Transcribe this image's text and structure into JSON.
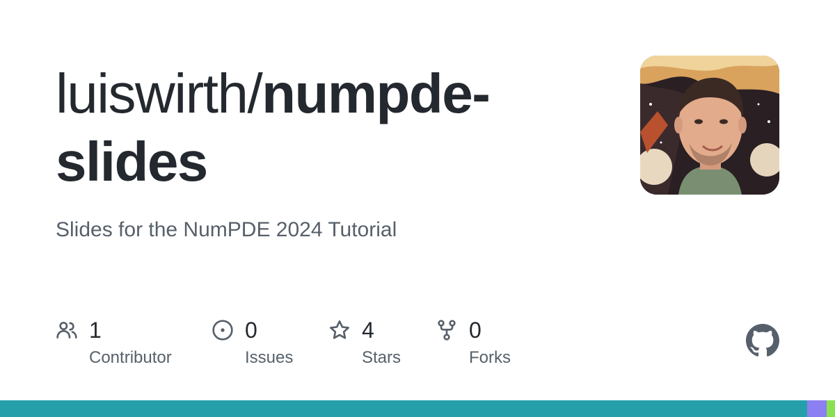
{
  "repo": {
    "owner": "luiswirth/",
    "name_line1": "numpde-",
    "name_line2": "slides",
    "description": "Slides for the NumPDE 2024 Tutorial"
  },
  "stats": [
    {
      "icon": "people-icon",
      "value": "1",
      "label": "Contributor"
    },
    {
      "icon": "issue-opened-icon",
      "value": "0",
      "label": "Issues"
    },
    {
      "icon": "star-icon",
      "value": "4",
      "label": "Stars"
    },
    {
      "icon": "repo-forked-icon",
      "value": "0",
      "label": "Forks"
    }
  ],
  "language_bar": [
    {
      "color": "#25a0ab",
      "fraction": 0.967
    },
    {
      "color": "#8c7ff2",
      "fraction": 0.023
    },
    {
      "color": "#89e051",
      "fraction": 0.01
    }
  ],
  "colors": {
    "text_primary": "#24292f",
    "text_secondary": "#57606a",
    "github_logo": "#57606a"
  }
}
